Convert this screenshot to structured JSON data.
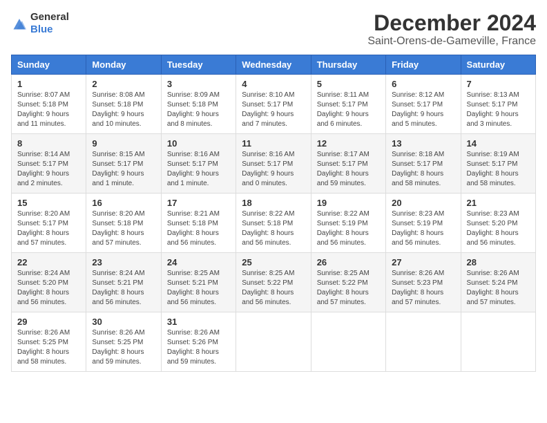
{
  "logo": {
    "general": "General",
    "blue": "Blue"
  },
  "title": "December 2024",
  "subtitle": "Saint-Orens-de-Gameville, France",
  "weekdays": [
    "Sunday",
    "Monday",
    "Tuesday",
    "Wednesday",
    "Thursday",
    "Friday",
    "Saturday"
  ],
  "weeks": [
    [
      {
        "day": "1",
        "rise": "Sunrise: 8:07 AM",
        "set": "Sunset: 5:18 PM",
        "daylight": "Daylight: 9 hours and 11 minutes."
      },
      {
        "day": "2",
        "rise": "Sunrise: 8:08 AM",
        "set": "Sunset: 5:18 PM",
        "daylight": "Daylight: 9 hours and 10 minutes."
      },
      {
        "day": "3",
        "rise": "Sunrise: 8:09 AM",
        "set": "Sunset: 5:18 PM",
        "daylight": "Daylight: 9 hours and 8 minutes."
      },
      {
        "day": "4",
        "rise": "Sunrise: 8:10 AM",
        "set": "Sunset: 5:17 PM",
        "daylight": "Daylight: 9 hours and 7 minutes."
      },
      {
        "day": "5",
        "rise": "Sunrise: 8:11 AM",
        "set": "Sunset: 5:17 PM",
        "daylight": "Daylight: 9 hours and 6 minutes."
      },
      {
        "day": "6",
        "rise": "Sunrise: 8:12 AM",
        "set": "Sunset: 5:17 PM",
        "daylight": "Daylight: 9 hours and 5 minutes."
      },
      {
        "day": "7",
        "rise": "Sunrise: 8:13 AM",
        "set": "Sunset: 5:17 PM",
        "daylight": "Daylight: 9 hours and 3 minutes."
      }
    ],
    [
      {
        "day": "8",
        "rise": "Sunrise: 8:14 AM",
        "set": "Sunset: 5:17 PM",
        "daylight": "Daylight: 9 hours and 2 minutes."
      },
      {
        "day": "9",
        "rise": "Sunrise: 8:15 AM",
        "set": "Sunset: 5:17 PM",
        "daylight": "Daylight: 9 hours and 1 minute."
      },
      {
        "day": "10",
        "rise": "Sunrise: 8:16 AM",
        "set": "Sunset: 5:17 PM",
        "daylight": "Daylight: 9 hours and 1 minute."
      },
      {
        "day": "11",
        "rise": "Sunrise: 8:16 AM",
        "set": "Sunset: 5:17 PM",
        "daylight": "Daylight: 9 hours and 0 minutes."
      },
      {
        "day": "12",
        "rise": "Sunrise: 8:17 AM",
        "set": "Sunset: 5:17 PM",
        "daylight": "Daylight: 8 hours and 59 minutes."
      },
      {
        "day": "13",
        "rise": "Sunrise: 8:18 AM",
        "set": "Sunset: 5:17 PM",
        "daylight": "Daylight: 8 hours and 58 minutes."
      },
      {
        "day": "14",
        "rise": "Sunrise: 8:19 AM",
        "set": "Sunset: 5:17 PM",
        "daylight": "Daylight: 8 hours and 58 minutes."
      }
    ],
    [
      {
        "day": "15",
        "rise": "Sunrise: 8:20 AM",
        "set": "Sunset: 5:17 PM",
        "daylight": "Daylight: 8 hours and 57 minutes."
      },
      {
        "day": "16",
        "rise": "Sunrise: 8:20 AM",
        "set": "Sunset: 5:18 PM",
        "daylight": "Daylight: 8 hours and 57 minutes."
      },
      {
        "day": "17",
        "rise": "Sunrise: 8:21 AM",
        "set": "Sunset: 5:18 PM",
        "daylight": "Daylight: 8 hours and 56 minutes."
      },
      {
        "day": "18",
        "rise": "Sunrise: 8:22 AM",
        "set": "Sunset: 5:18 PM",
        "daylight": "Daylight: 8 hours and 56 minutes."
      },
      {
        "day": "19",
        "rise": "Sunrise: 8:22 AM",
        "set": "Sunset: 5:19 PM",
        "daylight": "Daylight: 8 hours and 56 minutes."
      },
      {
        "day": "20",
        "rise": "Sunrise: 8:23 AM",
        "set": "Sunset: 5:19 PM",
        "daylight": "Daylight: 8 hours and 56 minutes."
      },
      {
        "day": "21",
        "rise": "Sunrise: 8:23 AM",
        "set": "Sunset: 5:20 PM",
        "daylight": "Daylight: 8 hours and 56 minutes."
      }
    ],
    [
      {
        "day": "22",
        "rise": "Sunrise: 8:24 AM",
        "set": "Sunset: 5:20 PM",
        "daylight": "Daylight: 8 hours and 56 minutes."
      },
      {
        "day": "23",
        "rise": "Sunrise: 8:24 AM",
        "set": "Sunset: 5:21 PM",
        "daylight": "Daylight: 8 hours and 56 minutes."
      },
      {
        "day": "24",
        "rise": "Sunrise: 8:25 AM",
        "set": "Sunset: 5:21 PM",
        "daylight": "Daylight: 8 hours and 56 minutes."
      },
      {
        "day": "25",
        "rise": "Sunrise: 8:25 AM",
        "set": "Sunset: 5:22 PM",
        "daylight": "Daylight: 8 hours and 56 minutes."
      },
      {
        "day": "26",
        "rise": "Sunrise: 8:25 AM",
        "set": "Sunset: 5:22 PM",
        "daylight": "Daylight: 8 hours and 57 minutes."
      },
      {
        "day": "27",
        "rise": "Sunrise: 8:26 AM",
        "set": "Sunset: 5:23 PM",
        "daylight": "Daylight: 8 hours and 57 minutes."
      },
      {
        "day": "28",
        "rise": "Sunrise: 8:26 AM",
        "set": "Sunset: 5:24 PM",
        "daylight": "Daylight: 8 hours and 57 minutes."
      }
    ],
    [
      {
        "day": "29",
        "rise": "Sunrise: 8:26 AM",
        "set": "Sunset: 5:25 PM",
        "daylight": "Daylight: 8 hours and 58 minutes."
      },
      {
        "day": "30",
        "rise": "Sunrise: 8:26 AM",
        "set": "Sunset: 5:25 PM",
        "daylight": "Daylight: 8 hours and 59 minutes."
      },
      {
        "day": "31",
        "rise": "Sunrise: 8:26 AM",
        "set": "Sunset: 5:26 PM",
        "daylight": "Daylight: 8 hours and 59 minutes."
      },
      null,
      null,
      null,
      null
    ]
  ]
}
